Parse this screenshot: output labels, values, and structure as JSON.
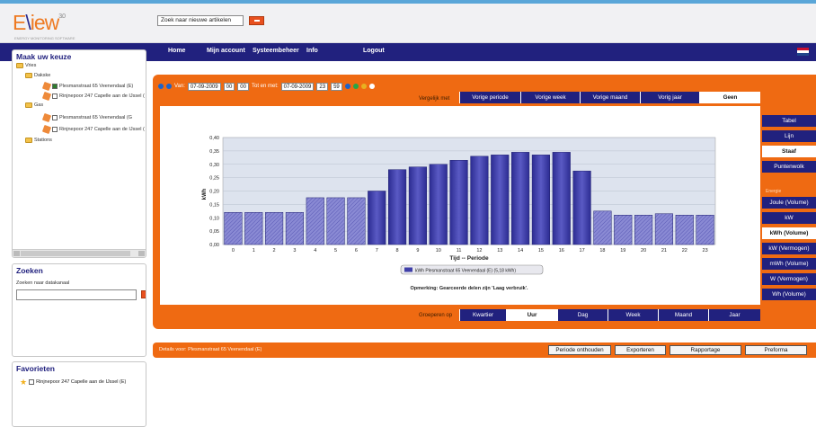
{
  "app": {
    "logo": "EView",
    "logo_sup": "3.0",
    "logo_sub": "ENERGY MONITORING SOFTWARE"
  },
  "topbar": {
    "search_text": "Zoek naar nieuwe artikelen"
  },
  "nav": {
    "items": [
      "Home",
      "Mijn account",
      "Systeembeheer",
      "Info",
      "Logout"
    ]
  },
  "sidebar": {
    "choice_title": "Maak uw keuze",
    "tree": [
      {
        "label": "Vries"
      },
      {
        "label": "Dakske"
      },
      {
        "label": "Plesmanstraat 65 Veenendaal (E)",
        "checked": true
      },
      {
        "label": "Rinjnepoor 247 Capelle aan de IJssel (",
        "checked": false
      },
      {
        "label": "Gas"
      },
      {
        "label": "Plesmanstraat 65 Veenendaal (G",
        "checked": false
      },
      {
        "label": "Rinjnepoor 247 Capelle aan de IJssel (",
        "checked": false
      },
      {
        "label": "Stations"
      }
    ],
    "search_title": "Zoeken",
    "search_label": "Zoeken naar datakanaal",
    "fav_title": "Favorieten",
    "fav_item": "Rinjnepoor 247 Capelle aan de IJssel (E)"
  },
  "controls": {
    "van_label": "Van:",
    "from_date": "07-09-2009",
    "from_h": "00",
    "from_m": "00",
    "tot_label": "Tot en met:",
    "to_date": "07-09-2009",
    "to_h": "23",
    "to_m": "59"
  },
  "compare": {
    "label": "Vergelijk met",
    "tabs": [
      "Vorige periode",
      "Vorige week",
      "Vorige maand",
      "Vorig jaar",
      "Geen"
    ],
    "selected": 4
  },
  "chart_tabs": [
    "Tabel",
    "Lijn",
    "Staaf",
    "Puntenwolk"
  ],
  "chart_tab_selected": 2,
  "energie_label": "Energie",
  "unit_tabs": [
    "Joule (Volume)",
    "kW",
    "kWh (Volume)",
    "kW (Vermogen)",
    "mWh (Volume)",
    "W (Vermogen)",
    "Wh (Volume)"
  ],
  "unit_tab_selected": 2,
  "group": {
    "label": "Groeperen op",
    "tabs": [
      "Kwartier",
      "Uur",
      "Dag",
      "Week",
      "Maand",
      "Jaar"
    ],
    "selected": 1
  },
  "details": {
    "text": "Details voor: Plesmanstraat 65 Veenendaal (E)",
    "buttons": [
      "Periode onthouden",
      "Exporteren",
      "Rapportage",
      "Preforma"
    ]
  },
  "colors": {
    "orange": "#ef6a12",
    "navy": "#21217e",
    "bar": "#3f3fa8",
    "bar_hatched": "#7b7bc9"
  },
  "chart_data": {
    "type": "bar",
    "categories": [
      "0",
      "1",
      "2",
      "3",
      "4",
      "5",
      "6",
      "7",
      "8",
      "9",
      "10",
      "11",
      "12",
      "13",
      "14",
      "15",
      "16",
      "17",
      "18",
      "19",
      "20",
      "21",
      "22",
      "23"
    ],
    "series": [
      {
        "name": "kWh Plesmanstraat 65 Veenendaal (E) (5,18 kWh)",
        "values": [
          0.12,
          0.12,
          0.12,
          0.12,
          0.175,
          0.175,
          0.175,
          0.2,
          0.28,
          0.29,
          0.3,
          0.315,
          0.33,
          0.335,
          0.345,
          0.335,
          0.345,
          0.275,
          0.125,
          0.11,
          0.11,
          0.115,
          0.11,
          0.11
        ]
      }
    ],
    "hatched": [
      0,
      1,
      2,
      3,
      4,
      5,
      6,
      18,
      19,
      20,
      21,
      22,
      23
    ],
    "xlabel": "Tijd -- Periode",
    "ylabel": "kWh",
    "ylim": [
      0,
      0.4
    ],
    "yticks": [
      "0,00",
      "0,05",
      "0,10",
      "0,15",
      "0,20",
      "0,25",
      "0,30",
      "0,35",
      "0,40"
    ],
    "note": "Opmerking: Gearceerde delen zijn 'Laag verbruik'."
  }
}
